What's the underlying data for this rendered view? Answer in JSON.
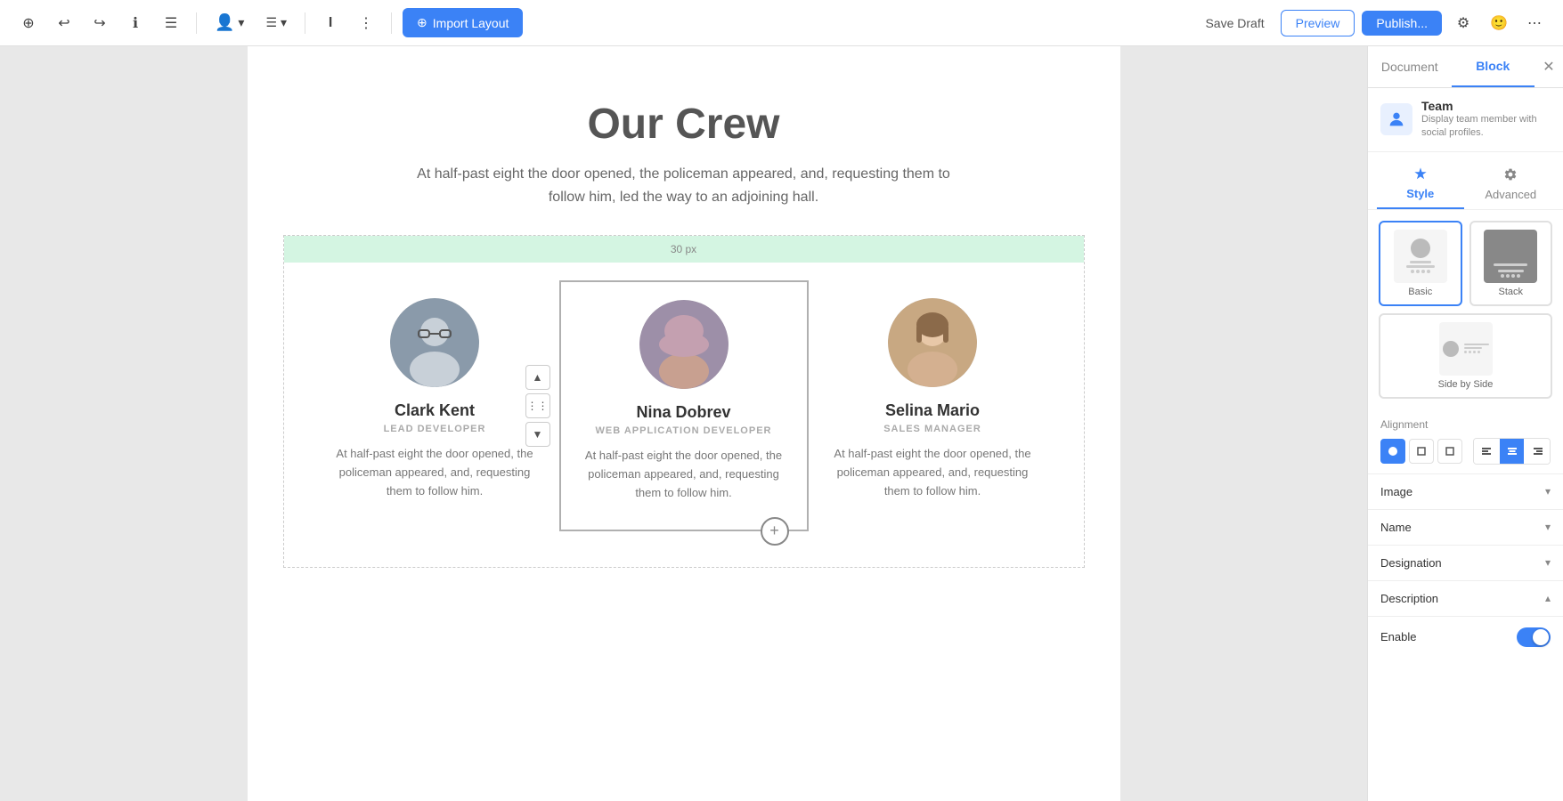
{
  "toolbar": {
    "import_label": "Import Layout",
    "save_draft_label": "Save Draft",
    "preview_label": "Preview",
    "publish_label": "Publish...",
    "undo_icon": "↩",
    "redo_icon": "↪",
    "info_icon": "ℹ",
    "menu_icon": "☰",
    "more_icon": "⋮",
    "user_icon": "👤",
    "gear_icon": "⚙",
    "ellipsis_icon": "⋯"
  },
  "page": {
    "title": "Our Crew",
    "subtitle": "At half-past eight the door opened, the policeman appeared, and, requesting them to\nfollow him, led the way to an adjoining hall."
  },
  "team_block": {
    "spacer_label": "30 px",
    "add_member_icon": "+",
    "members": [
      {
        "name": "Clark Kent",
        "role": "LEAD DEVELOPER",
        "description": "At half-past eight the door opened, the policeman appeared, and, requesting them to follow him."
      },
      {
        "name": "Nina Dobrev",
        "role": "WEB APPLICATION DEVELOPER",
        "description": "At half-past eight the door opened, the policeman appeared, and, requesting them to follow him."
      },
      {
        "name": "Selina Mario",
        "role": "SALES MANAGER",
        "description": "At half-past eight the door opened, the policeman appeared, and, requesting them to follow him."
      }
    ]
  },
  "right_panel": {
    "tabs": {
      "document_label": "Document",
      "block_label": "Block"
    },
    "block_info": {
      "title": "Team",
      "description": "Display team member with social profiles."
    },
    "style_tabs": {
      "style_label": "Style",
      "advanced_label": "Advanced"
    },
    "layouts": [
      {
        "label": "Basic",
        "selected": true
      },
      {
        "label": "Stack",
        "selected": false
      },
      {
        "label": "Side by Side",
        "selected": false
      }
    ],
    "alignment": {
      "label": "Alignment",
      "options": [
        "left",
        "center",
        "right"
      ]
    },
    "sections": [
      {
        "label": "Image",
        "expanded": false
      },
      {
        "label": "Name",
        "expanded": false
      },
      {
        "label": "Designation",
        "expanded": false
      },
      {
        "label": "Description",
        "expanded": true
      }
    ],
    "enable": {
      "label": "Enable",
      "value": true
    }
  }
}
